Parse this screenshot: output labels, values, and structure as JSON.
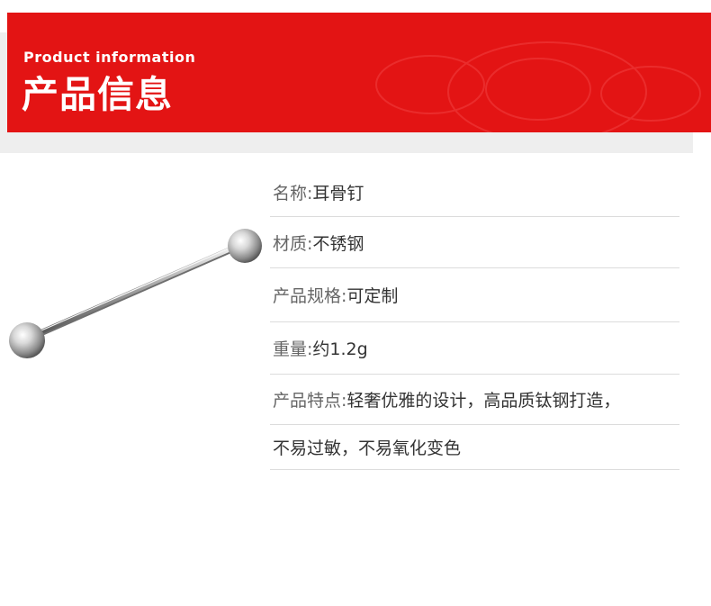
{
  "header": {
    "subtitle": "Product information",
    "title": "产品信息",
    "bg_color": "#e31414"
  },
  "product_image": {
    "icon": "barbell-earring-icon"
  },
  "info_rows": [
    {
      "label": "名称:",
      "value": "耳骨钉"
    },
    {
      "label": "材质:",
      "value": "不锈钢"
    },
    {
      "label": "产品规格:",
      "value": "可定制"
    },
    {
      "label": "重量:",
      "value": "约1.2g"
    },
    {
      "label": "产品特点:",
      "value": "轻奢优雅的设计，高品质钛钢打造，"
    },
    {
      "label": "",
      "value": "不易过敏，不易氧化变色"
    }
  ]
}
